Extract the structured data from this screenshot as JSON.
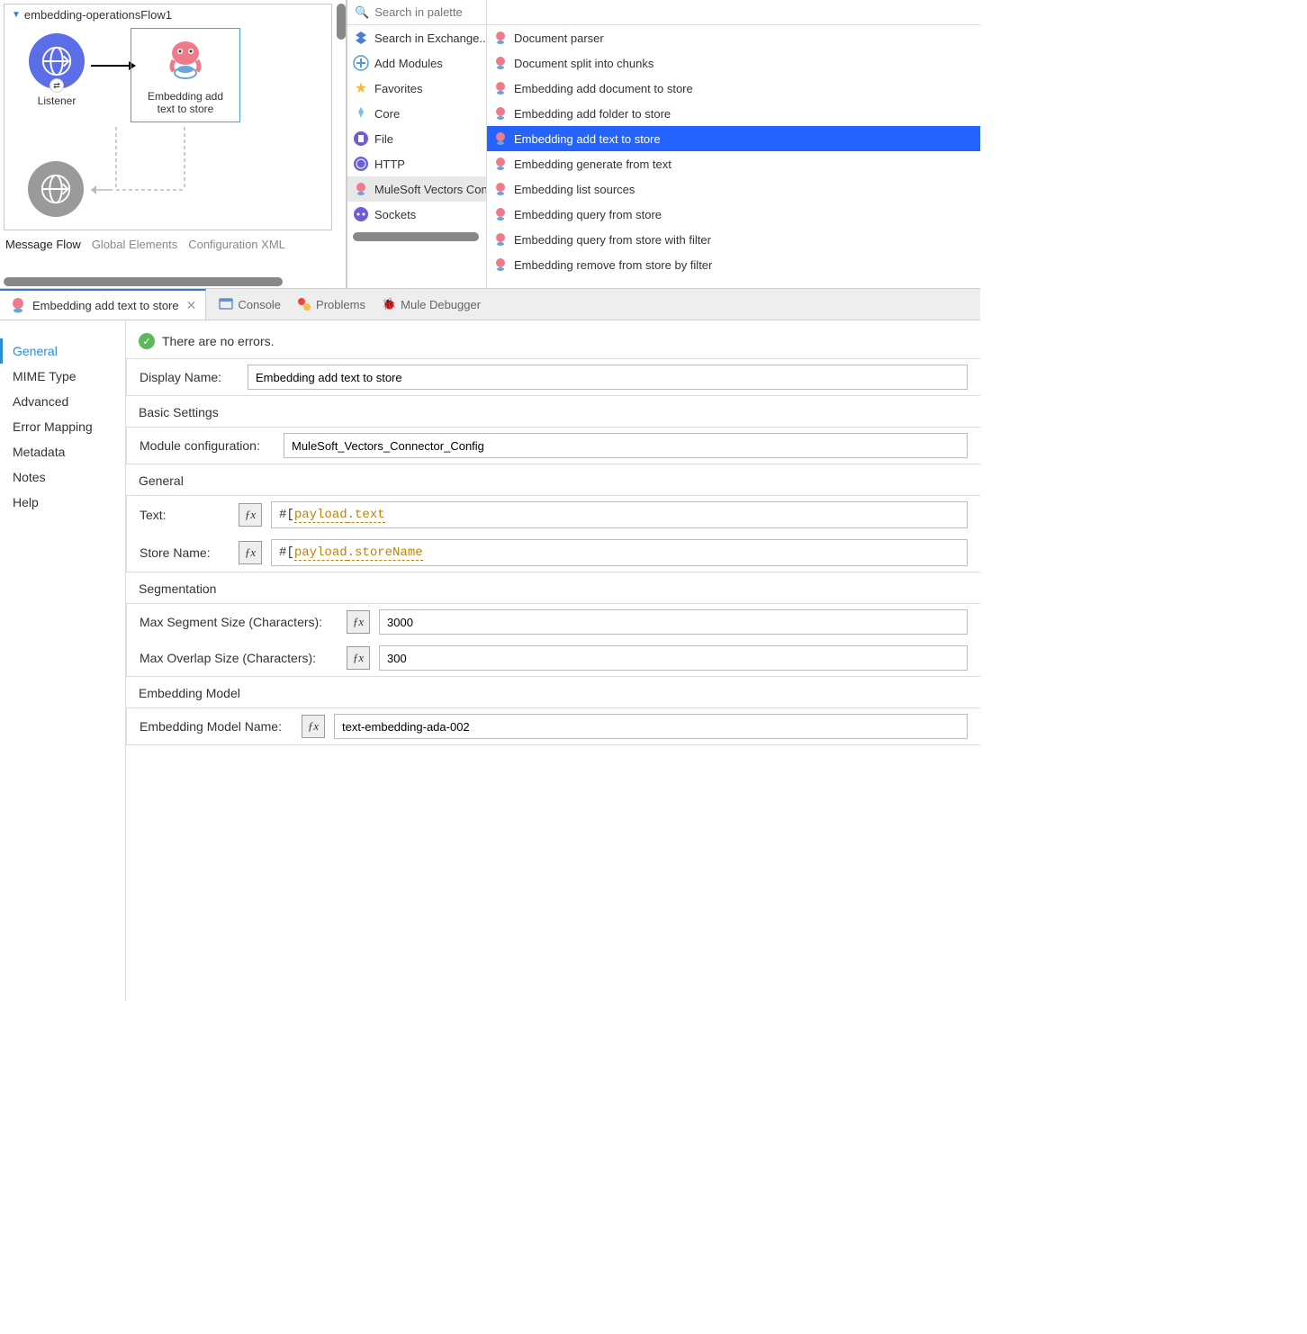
{
  "flow": {
    "title": "embedding-operationsFlow1",
    "listener_label": "Listener",
    "embed_label_line1": "Embedding add",
    "embed_label_line2": "text to store"
  },
  "canvas_tabs": {
    "message_flow": "Message Flow",
    "global_elements": "Global Elements",
    "config_xml": "Configuration XML"
  },
  "palette": {
    "search_placeholder": "Search in palette",
    "left": [
      {
        "label": "Search in Exchange..",
        "icon": "exchange"
      },
      {
        "label": "Add Modules",
        "icon": "plus"
      },
      {
        "label": "Favorites",
        "icon": "star"
      },
      {
        "label": "Core",
        "icon": "core"
      },
      {
        "label": "File",
        "icon": "file"
      },
      {
        "label": "HTTP",
        "icon": "http"
      },
      {
        "label": "MuleSoft Vectors Con",
        "icon": "octo",
        "selected": true
      },
      {
        "label": "Sockets",
        "icon": "socket"
      }
    ],
    "right": [
      {
        "label": "Document parser"
      },
      {
        "label": "Document split into chunks"
      },
      {
        "label": "Embedding add document to store"
      },
      {
        "label": "Embedding add folder to store"
      },
      {
        "label": "Embedding add text to store",
        "selected": true
      },
      {
        "label": "Embedding generate from text"
      },
      {
        "label": "Embedding list sources"
      },
      {
        "label": "Embedding query from store"
      },
      {
        "label": "Embedding query from store with filter"
      },
      {
        "label": "Embedding remove from store by filter"
      }
    ]
  },
  "mid": {
    "tab_title": "Embedding add text to store",
    "console": "Console",
    "problems": "Problems",
    "debugger": "Mule Debugger"
  },
  "props": {
    "sidebar": [
      "General",
      "MIME Type",
      "Advanced",
      "Error Mapping",
      "Metadata",
      "Notes",
      "Help"
    ],
    "no_errors": "There are no errors.",
    "display_name_label": "Display Name:",
    "display_name_value": "Embedding add text to store",
    "basic_settings": "Basic Settings",
    "module_config_label": "Module configuration:",
    "module_config_value": "MuleSoft_Vectors_Connector_Config",
    "general_title": "General",
    "text_label": "Text:",
    "text_value_prefix": "#[ ",
    "text_value_payload": "payload",
    "text_value_suffix": ".text",
    "store_label": "Store Name:",
    "store_value_suffix": ".storeName",
    "segmentation_title": "Segmentation",
    "max_seg_label": "Max Segment Size (Characters):",
    "max_seg_value": "3000",
    "max_overlap_label": "Max Overlap Size (Characters):",
    "max_overlap_value": "300",
    "embed_model_title": "Embedding Model",
    "embed_model_label": "Embedding Model Name:",
    "embed_model_value": "text-embedding-ada-002"
  }
}
